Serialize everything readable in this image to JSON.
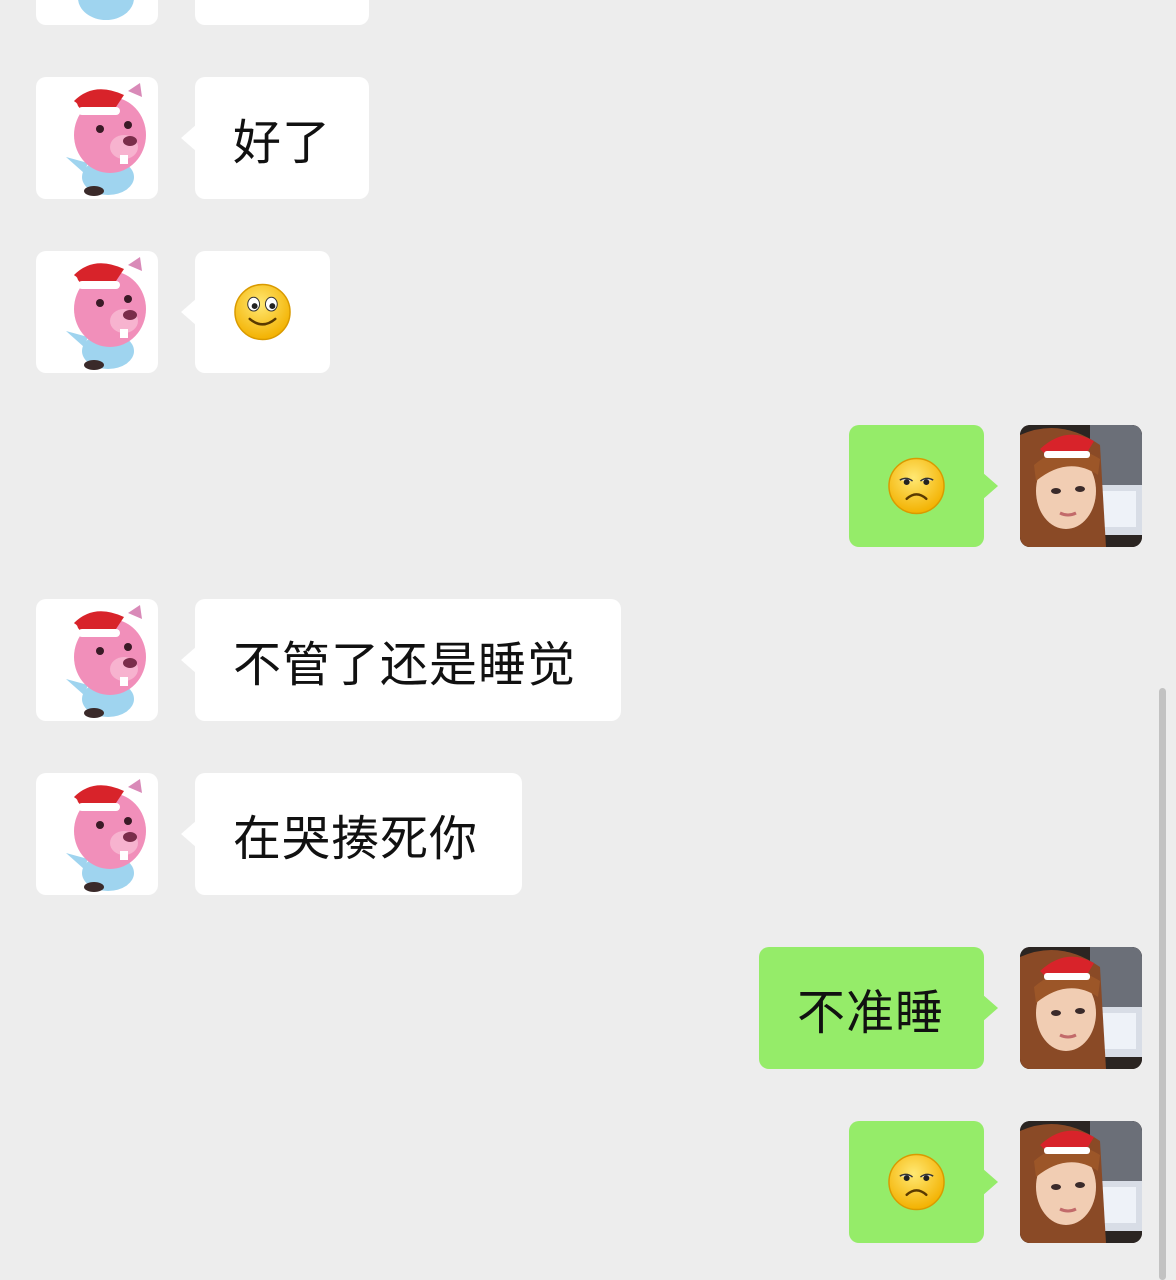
{
  "chat": {
    "background": "#ededed",
    "incoming_bubble_color": "#ffffff",
    "outgoing_bubble_color": "#95ec69",
    "messages": [
      {
        "sender": "other",
        "type": "text",
        "text": "好了"
      },
      {
        "sender": "other",
        "type": "emoji",
        "emoji": "smile-emoji"
      },
      {
        "sender": "me",
        "type": "emoji",
        "emoji": "sad-emoji"
      },
      {
        "sender": "other",
        "type": "text",
        "text": "不管了还是睡觉"
      },
      {
        "sender": "other",
        "type": "text",
        "text": "在哭揍死你"
      },
      {
        "sender": "me",
        "type": "text",
        "text": "不准睡"
      },
      {
        "sender": "me",
        "type": "emoji",
        "emoji": "sad-emoji"
      }
    ]
  }
}
